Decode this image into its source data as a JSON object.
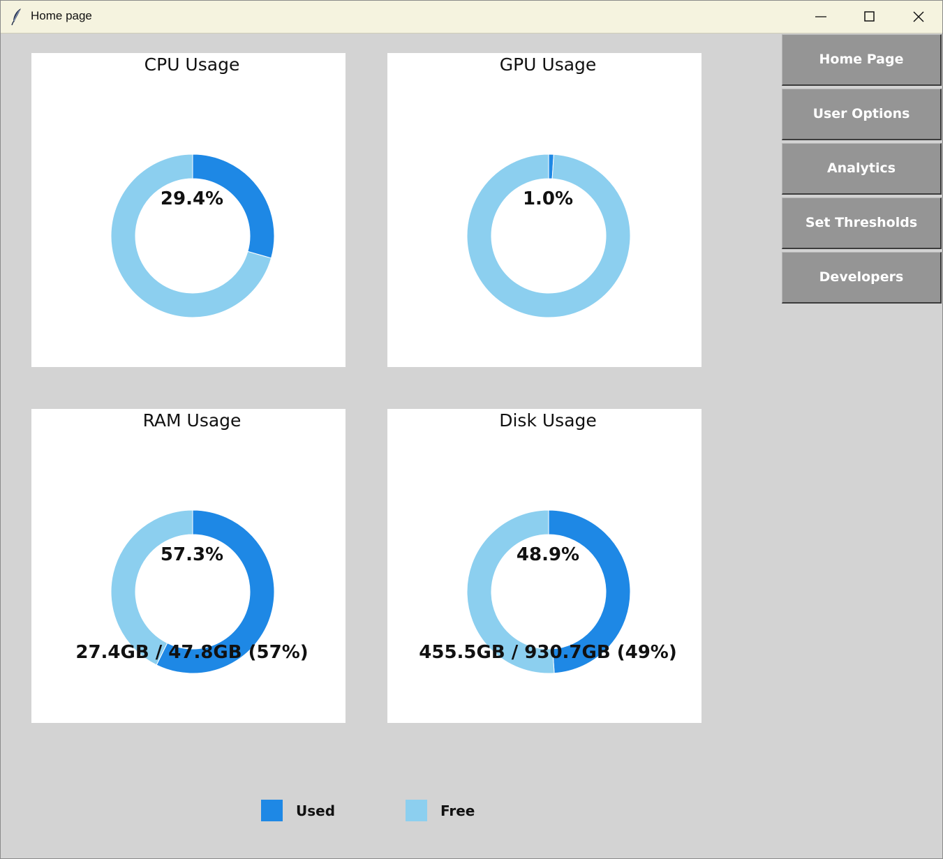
{
  "window": {
    "title": "Home page",
    "icon": "feather-icon",
    "controls": [
      "minimize-icon",
      "maximize-icon",
      "close-icon"
    ]
  },
  "colors": {
    "used": "#1e88e5",
    "free": "#8ccfef",
    "background": "#d3d3d3",
    "nav_button": "#959595"
  },
  "nav": {
    "items": [
      {
        "label": "Home Page"
      },
      {
        "label": "User Options"
      },
      {
        "label": "Analytics"
      },
      {
        "label": "Set Thresholds"
      },
      {
        "label": "Developers"
      }
    ]
  },
  "legend": {
    "used": "Used",
    "free": "Free"
  },
  "chart_data": [
    {
      "type": "pie",
      "title": "CPU Usage",
      "categories": [
        "Used",
        "Free"
      ],
      "values": [
        29.4,
        70.6
      ],
      "center_label": "29.4%",
      "detail": ""
    },
    {
      "type": "pie",
      "title": "GPU Usage",
      "categories": [
        "Used",
        "Free"
      ],
      "values": [
        1.0,
        99.0
      ],
      "center_label": "1.0%",
      "detail": ""
    },
    {
      "type": "pie",
      "title": "RAM Usage",
      "categories": [
        "Used",
        "Free"
      ],
      "values": [
        57.3,
        42.7
      ],
      "center_label": "57.3%",
      "detail": "27.4GB / 47.8GB (57%)"
    },
    {
      "type": "pie",
      "title": "Disk Usage",
      "categories": [
        "Used",
        "Free"
      ],
      "values": [
        48.9,
        51.1
      ],
      "center_label": "48.9%",
      "detail": "455.5GB / 930.7GB (49%)"
    }
  ]
}
